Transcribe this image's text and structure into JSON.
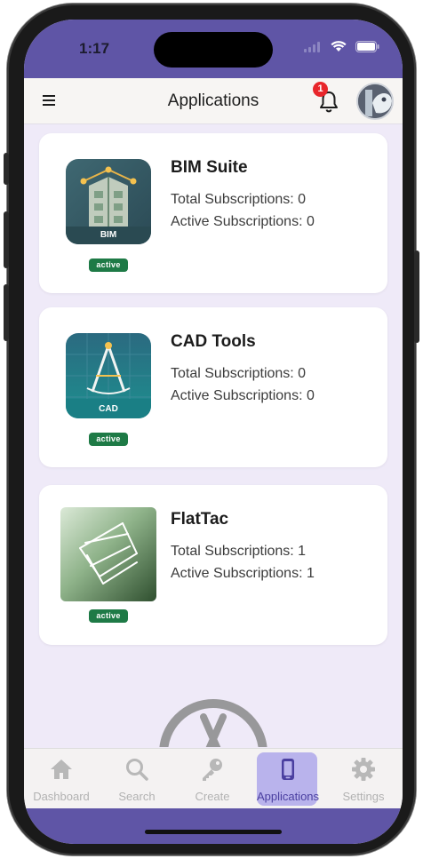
{
  "status_bar": {
    "time": "1:17"
  },
  "header": {
    "title": "Applications",
    "notification_count": "1"
  },
  "applications": [
    {
      "name": "BIM Suite",
      "icon_caption": "BIM",
      "status": "active",
      "total_subscriptions": "Total Subscriptions: 0",
      "active_subscriptions": "Active Subscriptions: 0"
    },
    {
      "name": "CAD Tools",
      "icon_caption": "CAD",
      "status": "active",
      "total_subscriptions": "Total Subscriptions: 0",
      "active_subscriptions": "Active Subscriptions: 0"
    },
    {
      "name": "FlatTac",
      "icon_caption": "",
      "status": "active",
      "total_subscriptions": "Total Subscriptions: 1",
      "active_subscriptions": "Active Subscriptions: 1"
    }
  ],
  "bottom_nav": {
    "items": [
      {
        "label": "Dashboard",
        "icon": "home-icon"
      },
      {
        "label": "Search",
        "icon": "search-icon"
      },
      {
        "label": "Create",
        "icon": "key-icon"
      },
      {
        "label": "Applications",
        "icon": "phone-icon",
        "active": true
      },
      {
        "label": "Settings",
        "icon": "gear-icon"
      }
    ]
  },
  "colors": {
    "brand_purple": "#5f55a6",
    "active_badge": "#1e7a46",
    "nav_active_bg": "#b9b3ec",
    "notification_badge": "#e8262b"
  }
}
